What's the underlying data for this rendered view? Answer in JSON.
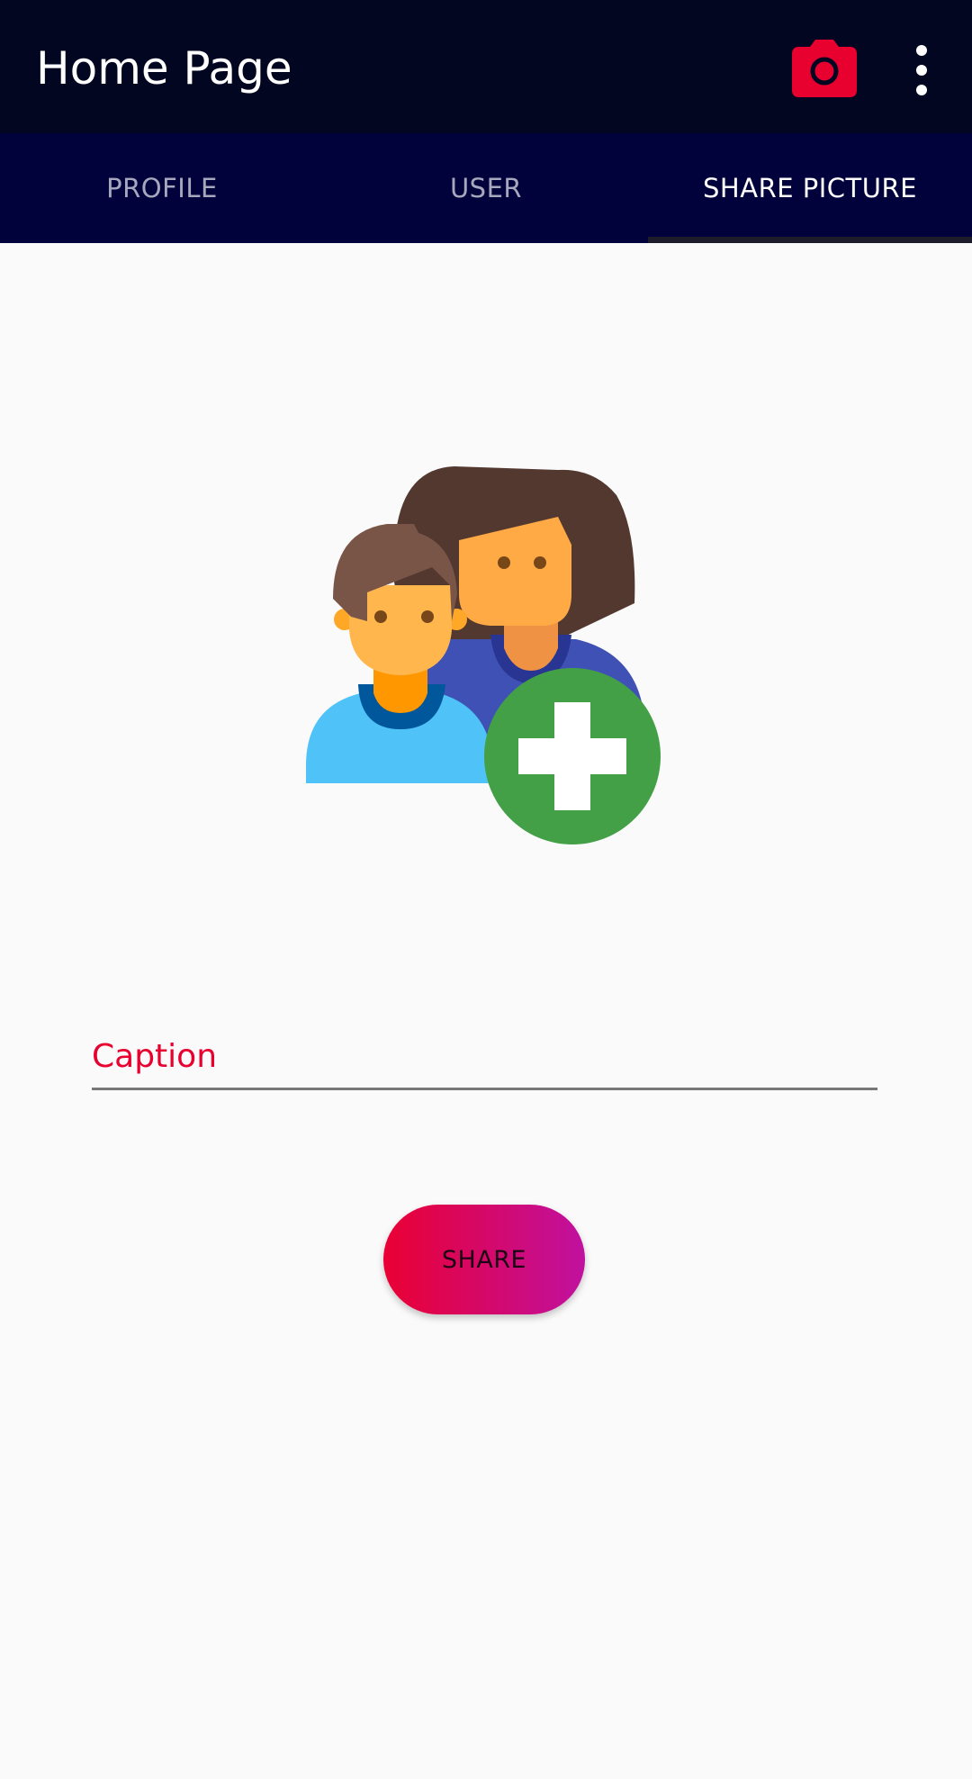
{
  "appbar": {
    "title": "Home Page",
    "camera_icon": "camera-icon",
    "more_icon": "more-vert-icon",
    "accent_color": "#e8002f"
  },
  "tabs": [
    {
      "label": "PROFILE",
      "active": false
    },
    {
      "label": "USER",
      "active": false
    },
    {
      "label": "SHARE PICTURE",
      "active": true
    }
  ],
  "illustration": {
    "icon": "add-users-icon"
  },
  "form": {
    "caption_placeholder": "Caption",
    "caption_value": "",
    "share_label": "SHARE"
  },
  "colors": {
    "appbar_bg": "#030621",
    "tabbar_bg": "#01013b",
    "button_gradient_start": "#ea0033",
    "button_gradient_end": "#c0119f"
  }
}
